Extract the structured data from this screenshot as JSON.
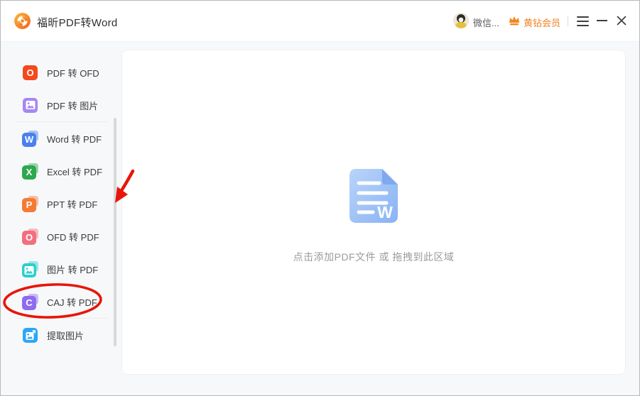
{
  "titlebar": {
    "app_title": "福昕PDF转Word",
    "account_label": "微信...",
    "vip_label": "黄钻会员",
    "icons": [
      "foxit-logo-icon",
      "qq-avatar",
      "crown-icon",
      "menu-icon",
      "minimize-icon",
      "close-icon"
    ]
  },
  "sidebar": {
    "items": [
      {
        "name": "pdf-to-ofd",
        "label": "PDF 转 OFD",
        "color": "#f4491c",
        "glyph": "O",
        "glyph_type": "letter",
        "stacked": false
      },
      {
        "name": "pdf-to-image",
        "label": "PDF 转 图片",
        "color": "#a687f2",
        "glyph": "image",
        "glyph_type": "image",
        "stacked": false
      },
      {
        "name": "word-to-pdf",
        "label": "Word 转 PDF",
        "color": "#4a80ee",
        "glyph": "W",
        "glyph_type": "letter",
        "stacked": true
      },
      {
        "name": "excel-to-pdf",
        "label": "Excel 转 PDF",
        "color": "#2ea84d",
        "glyph": "X",
        "glyph_type": "letter",
        "stacked": true
      },
      {
        "name": "ppt-to-pdf",
        "label": "PPT 转 PDF",
        "color": "#f57a33",
        "glyph": "P",
        "glyph_type": "letter",
        "stacked": true
      },
      {
        "name": "ofd-to-pdf",
        "label": "OFD 转 PDF",
        "color": "#f26f7f",
        "glyph": "O",
        "glyph_type": "letter",
        "stacked": true
      },
      {
        "name": "image-to-pdf",
        "label": "图片 转 PDF",
        "color": "#2bcfce",
        "glyph": "image",
        "glyph_type": "image",
        "stacked": true
      },
      {
        "name": "caj-to-pdf",
        "label": "CAJ 转 PDF",
        "color": "#8d6cf0",
        "glyph": "C",
        "glyph_type": "letter",
        "stacked": true
      },
      {
        "name": "extract-images",
        "label": "提取图片",
        "color": "#2ba7f5",
        "glyph": "image-extract",
        "glyph_type": "image-extract",
        "stacked": false
      }
    ],
    "divider_after": [
      1,
      7
    ]
  },
  "main": {
    "drop_hint": "点击添加PDF文件 或 拖拽到此区域",
    "doc_icon": "word-document-icon"
  },
  "annotations": {
    "arrow": "red-arrow-pointing-to-sidebar-scrollbar",
    "ellipse": "red-circle-around-caj-to-pdf",
    "color": "#e8150a"
  },
  "colors": {
    "accent_orange": "#f0831e",
    "window_background": "#f7f8fa",
    "panel_background": "#ffffff",
    "doc_icon_blue": "#8ab4f4"
  }
}
